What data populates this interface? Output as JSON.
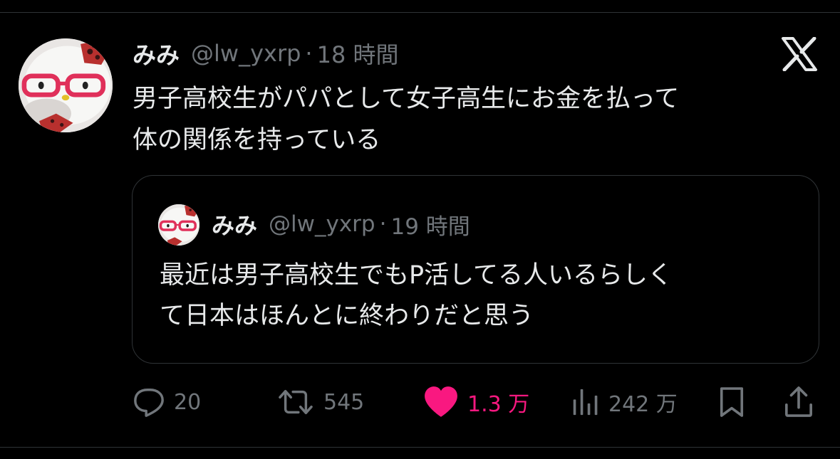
{
  "tweet": {
    "display_name": "みみ",
    "handle": "@lw_yxrp",
    "separator": "·",
    "time": "18 時間",
    "text_lines": [
      "男子高校生がパパとして女子高生にお金を払って",
      "体の関係を持っている"
    ]
  },
  "quoted_tweet": {
    "display_name": "みみ",
    "handle": "@lw_yxrp",
    "separator": "·",
    "time": "19 時間",
    "text_lines": [
      "最近は男子高校生でもP活してる人いるらしく",
      "て日本はほんとに終わりだと思う"
    ]
  },
  "actions": {
    "replies": "20",
    "reposts": "545",
    "likes": "1.3 万",
    "views": "242 万"
  },
  "colors": {
    "background": "#000000",
    "text": "#e7e9ea",
    "muted": "#71767b",
    "border": "#2f3336",
    "like": "#f91880"
  },
  "icons": {
    "brand": "x-logo-icon",
    "reply": "reply-icon",
    "repost": "repost-icon",
    "like": "heart-icon",
    "views": "views-icon",
    "bookmark": "bookmark-icon",
    "share": "share-icon"
  }
}
